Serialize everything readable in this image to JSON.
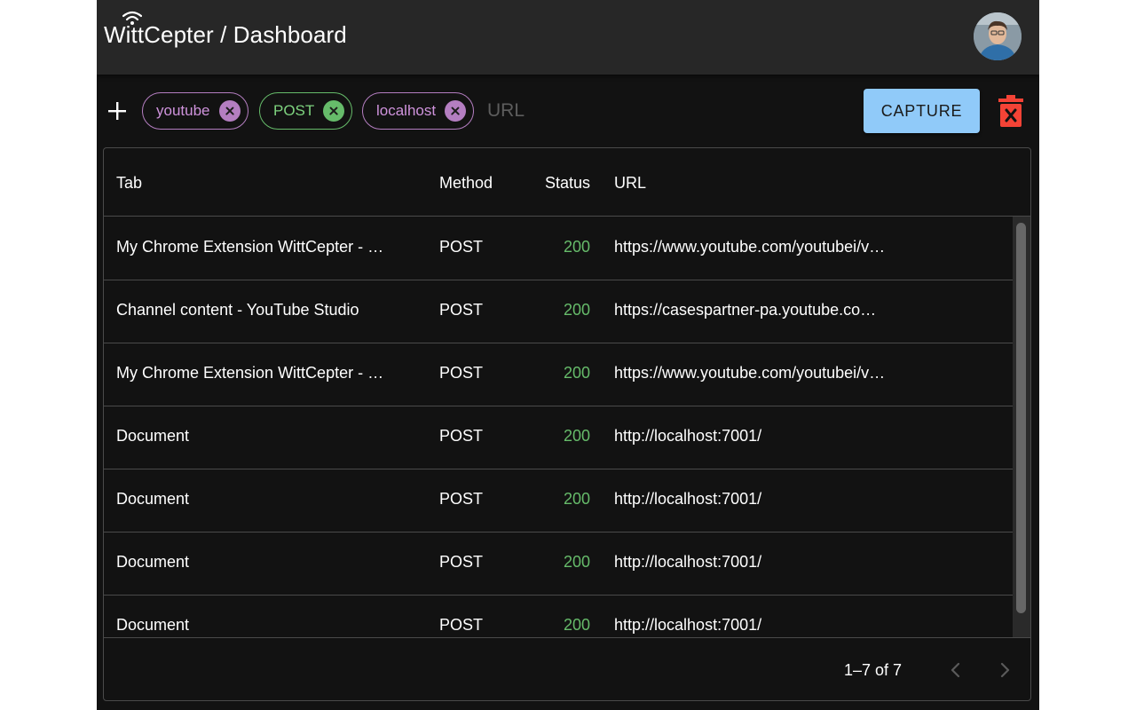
{
  "header": {
    "title": "WittCepter / Dashboard",
    "logo_icon": "wifi-icon",
    "avatar": "user-avatar"
  },
  "toolbar": {
    "add_icon": "plus-icon",
    "filters": [
      {
        "label": "youtube",
        "color": "#b47ec1"
      },
      {
        "label": "POST",
        "color": "#66bb6a"
      },
      {
        "label": "localhost",
        "color": "#b47ec1"
      }
    ],
    "url_placeholder": "URL",
    "capture_label": "CAPTURE",
    "capture_color": "#90caf9",
    "trash_icon": "trash-icon",
    "trash_color": "#f44336"
  },
  "table": {
    "columns": [
      "Tab",
      "Method",
      "Status",
      "URL"
    ],
    "rows": [
      {
        "tab": "My Chrome Extension WittCepter - …",
        "method": "POST",
        "status": "200",
        "url": "https://www.youtube.com/youtubei/v…"
      },
      {
        "tab": "Channel content - YouTube Studio",
        "method": "POST",
        "status": "200",
        "url": "https://casespartner-pa.youtube.co…"
      },
      {
        "tab": "My Chrome Extension WittCepter - …",
        "method": "POST",
        "status": "200",
        "url": "https://www.youtube.com/youtubei/v…"
      },
      {
        "tab": "Document",
        "method": "POST",
        "status": "200",
        "url": "http://localhost:7001/"
      },
      {
        "tab": "Document",
        "method": "POST",
        "status": "200",
        "url": "http://localhost:7001/"
      },
      {
        "tab": "Document",
        "method": "POST",
        "status": "200",
        "url": "http://localhost:7001/"
      },
      {
        "tab": "Document",
        "method": "POST",
        "status": "200",
        "url": "http://localhost:7001/"
      }
    ],
    "status_color": "#66bb6a"
  },
  "pagination": {
    "range_text": "1–7 of 7",
    "prev_icon": "chevron-left-icon",
    "next_icon": "chevron-right-icon"
  }
}
